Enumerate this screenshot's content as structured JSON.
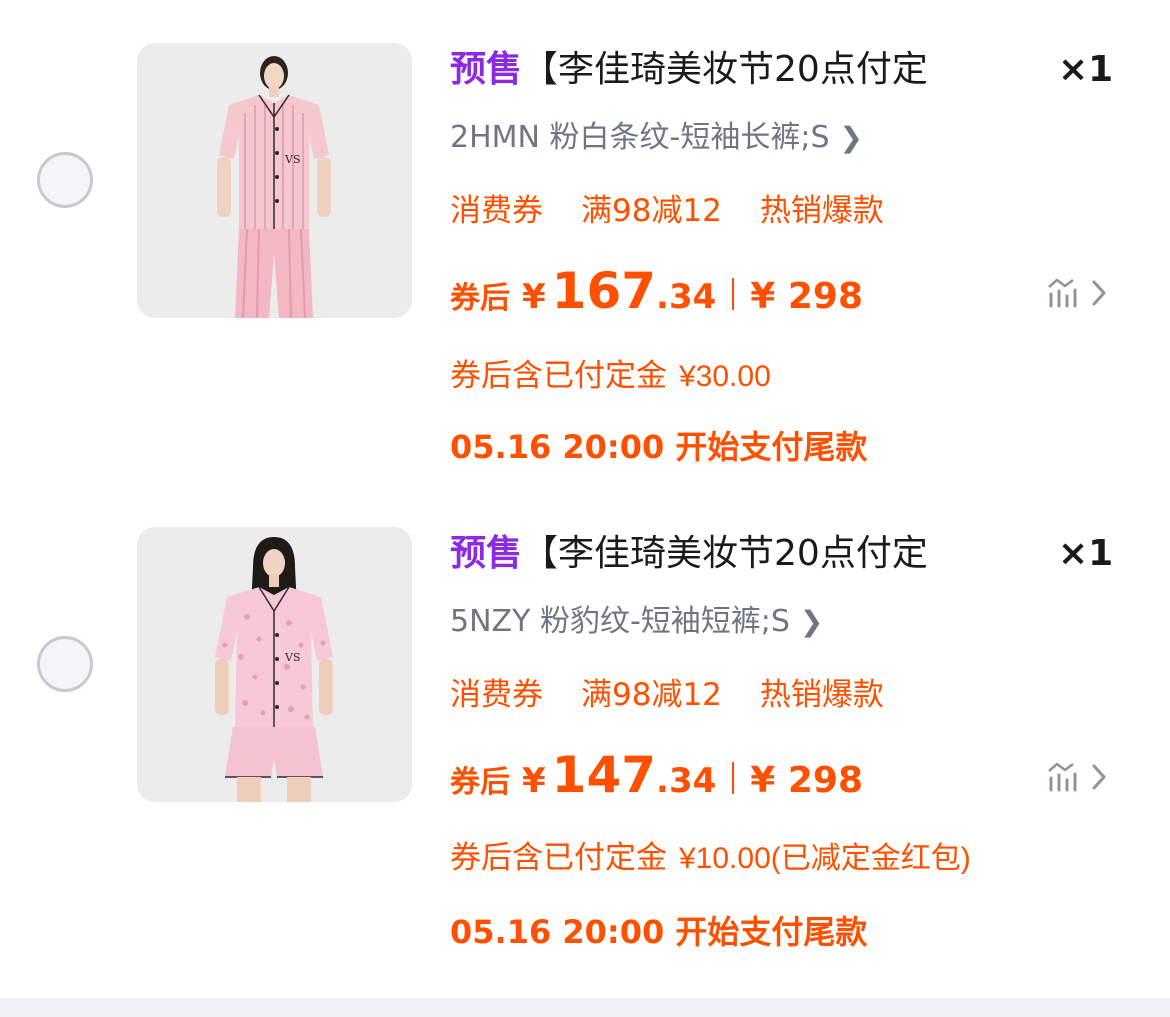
{
  "items": [
    {
      "tag": "预售",
      "title": "【李佳琦美妆节20点付定",
      "quantity": "×1",
      "sku": "2HMN 粉白条纹-短袖长裤;S",
      "promos": [
        "消费券",
        "满98减12",
        "热销爆款"
      ],
      "price_prefix": "券后",
      "price_symbol": "¥",
      "price_int": "167",
      "price_dec": ".34",
      "original_price": "¥ 298",
      "deposit_label": "券后含已付定金",
      "deposit_amount": "¥30.00",
      "balance_text": "05.16 20:00 开始支付尾款"
    },
    {
      "tag": "预售",
      "title": "【李佳琦美妆节20点付定",
      "quantity": "×1",
      "sku": "5NZY 粉豹纹-短袖短裤;S",
      "promos": [
        "消费券",
        "满98减12",
        "热销爆款"
      ],
      "price_prefix": "券后",
      "price_symbol": "¥",
      "price_int": "147",
      "price_dec": ".34",
      "original_price": "¥ 298",
      "deposit_label": "券后含已付定金",
      "deposit_amount": "¥10.00(已减定金红包)",
      "balance_text": "05.16 20:00 开始支付尾款"
    }
  ],
  "icons": {
    "radio": "radio-unchecked-icon",
    "sku_chevron": "chevron-right-icon",
    "trend": "price-trend-icon"
  },
  "colors": {
    "accent": "#ff5000",
    "presale": "#8a2be2",
    "title": "#1a1a1a",
    "sku": "#6f7582"
  }
}
